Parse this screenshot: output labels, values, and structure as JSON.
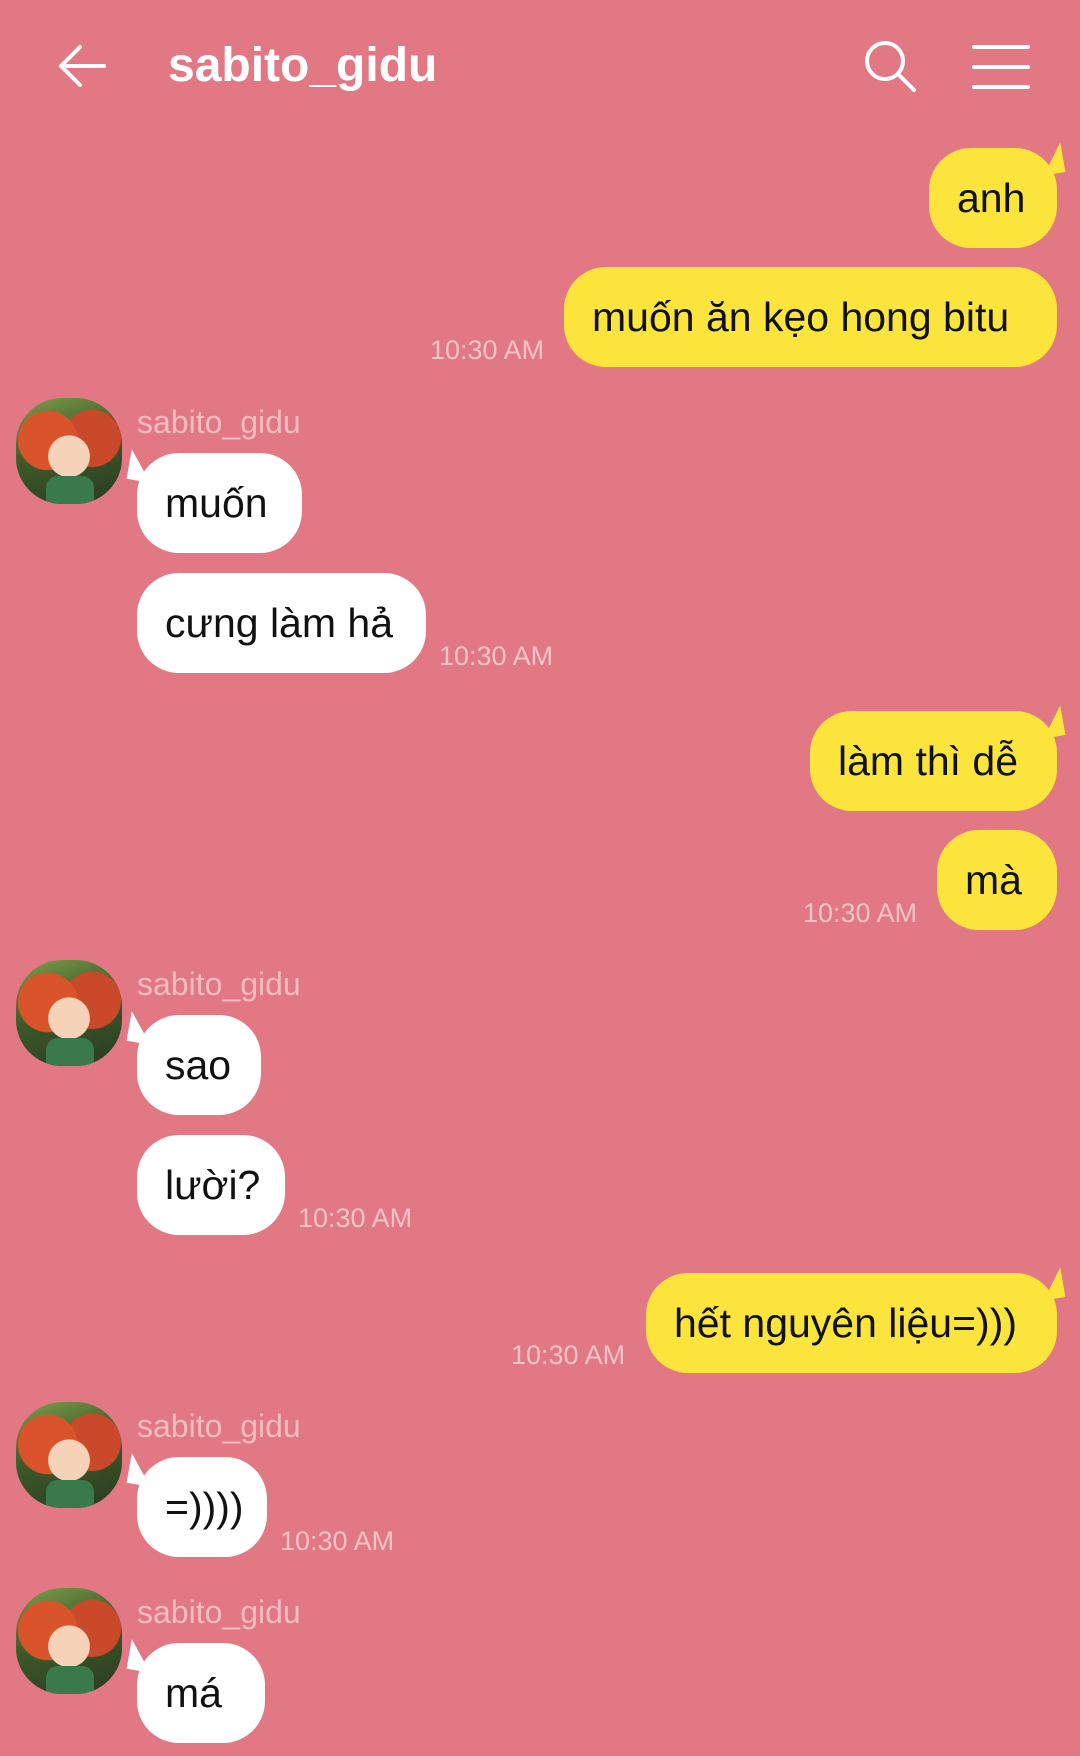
{
  "header": {
    "title": "sabito_gidu",
    "back_icon": "arrow-left-icon",
    "search_icon": "search-icon",
    "menu_icon": "hamburger-menu-icon"
  },
  "colors": {
    "background": "#e27883",
    "outgoing_bubble": "#fbe53c",
    "incoming_bubble": "#ffffff"
  },
  "messages": {
    "m1": {
      "text": "anh"
    },
    "m2": {
      "text": "muốn ăn kẹo hong bitu",
      "time": "10:30 AM"
    },
    "m3": {
      "sender": "sabito_gidu",
      "text": "muốn"
    },
    "m4": {
      "text": "cưng làm hả",
      "time": "10:30 AM"
    },
    "m5": {
      "text": "làm thì dễ"
    },
    "m6": {
      "text": "mà",
      "time": "10:30 AM"
    },
    "m7": {
      "sender": "sabito_gidu",
      "text": "sao"
    },
    "m8": {
      "text": "lười?",
      "time": "10:30 AM"
    },
    "m9": {
      "text": "hết nguyên liệu=)))",
      "time": "10:30 AM"
    },
    "m10": {
      "sender": "sabito_gidu",
      "text": "=))))",
      "time": "10:30 AM"
    },
    "m11": {
      "sender": "sabito_gidu",
      "text": "má"
    }
  }
}
